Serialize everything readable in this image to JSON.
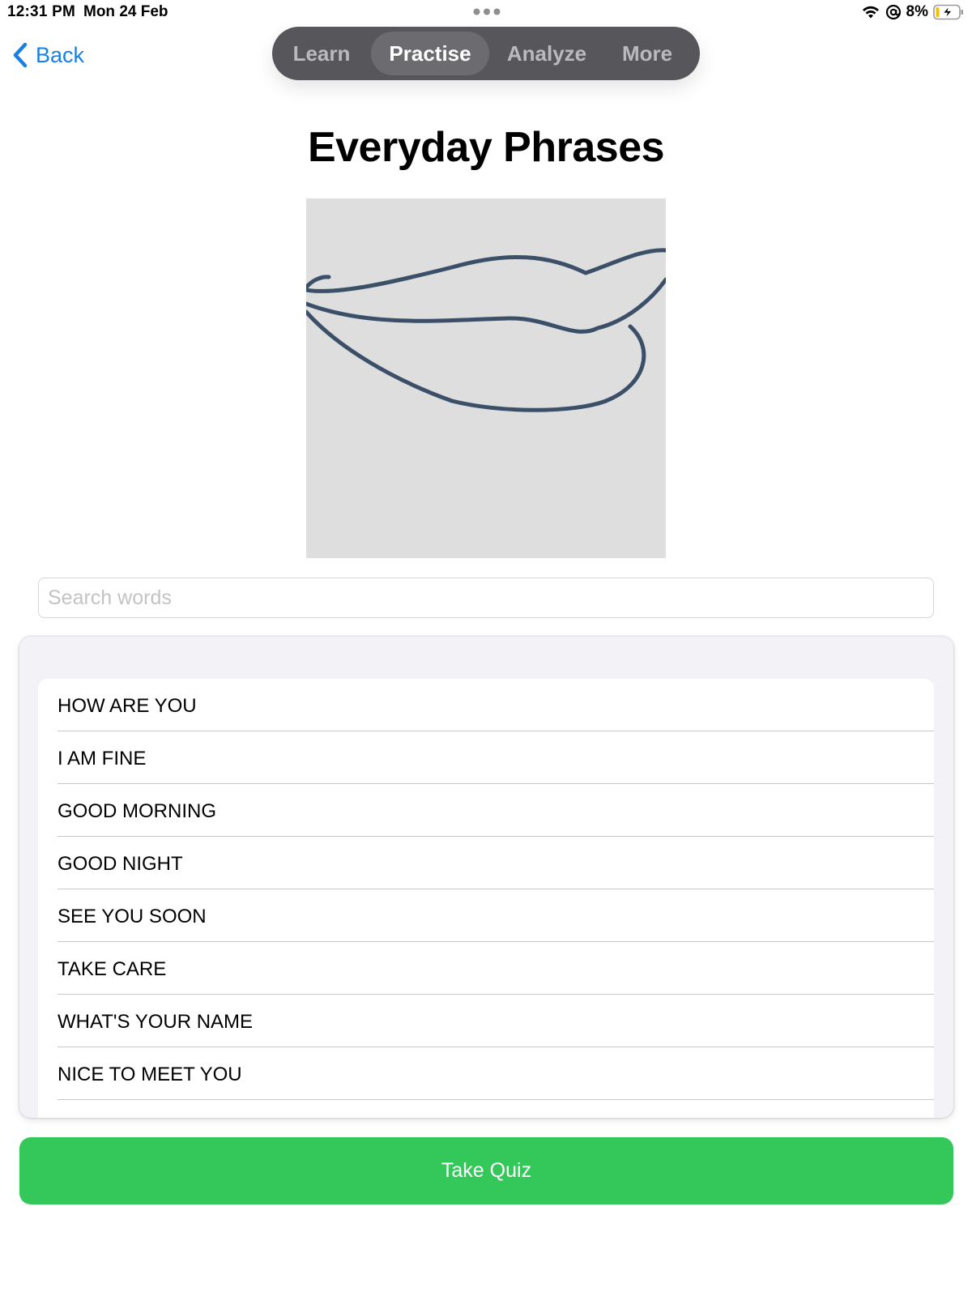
{
  "status_bar": {
    "time": "12:31 PM",
    "date": "Mon 24 Feb",
    "battery_percent": "8%",
    "icons": [
      "wifi-icon",
      "at-sign-icon",
      "battery-charging-icon"
    ]
  },
  "nav": {
    "back_label": "Back",
    "tabs": [
      {
        "label": "Learn",
        "active": false
      },
      {
        "label": "Practise",
        "active": true
      },
      {
        "label": "Analyze",
        "active": false
      },
      {
        "label": "More",
        "active": false
      }
    ]
  },
  "page": {
    "title": "Everyday Phrases",
    "illustration": "lips-illustration"
  },
  "search": {
    "placeholder": "Search words",
    "value": ""
  },
  "phrases": [
    "HOW ARE YOU",
    "I AM FINE",
    "GOOD MORNING",
    "GOOD NIGHT",
    "SEE YOU SOON",
    "TAKE CARE",
    "WHAT'S YOUR NAME",
    "NICE TO MEET YOU"
  ],
  "quiz": {
    "label": "Take Quiz"
  },
  "colors": {
    "accent": "#1a7fe3",
    "quiz_button": "#34c759",
    "segmented_bg": "#56565b",
    "segmented_active": "#6b6b70"
  }
}
